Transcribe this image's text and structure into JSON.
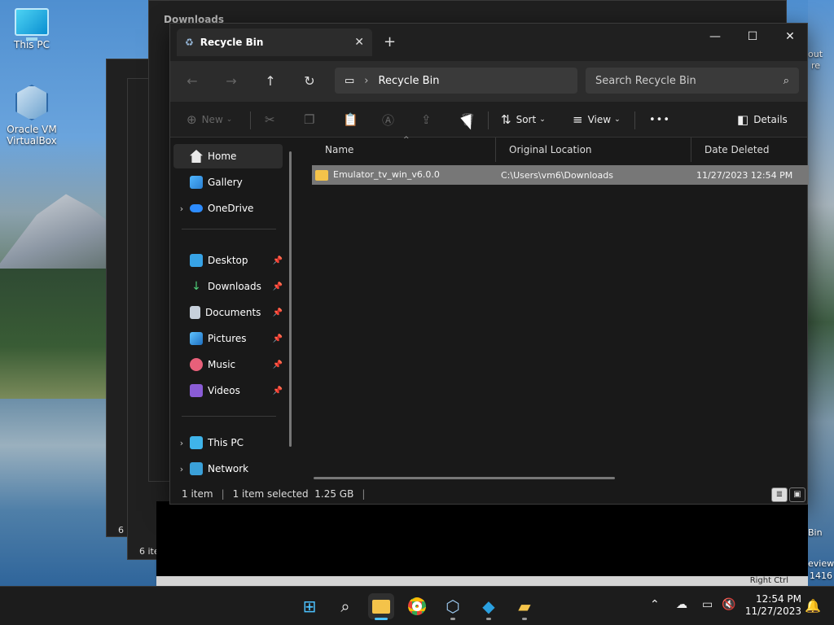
{
  "desktop": {
    "icons": [
      {
        "label": "This PC"
      },
      {
        "label": "Oracle VM VirtualBox"
      }
    ],
    "edge_texts": [
      "out",
      "re",
      "Bin",
      "eview",
      "1416"
    ]
  },
  "background_windows": {
    "downloads_tab": "Downloads",
    "items_count": "6 i",
    "items_count2": "6 ite",
    "vm_status": "Right Ctrl"
  },
  "window": {
    "tab_title": "Recycle Bin",
    "address": {
      "location": "Recycle Bin"
    },
    "search": {
      "placeholder": "Search Recycle Bin"
    },
    "toolbar": {
      "new_label": "New",
      "sort_label": "Sort",
      "view_label": "View",
      "more_label": "•••",
      "details_label": "Details"
    },
    "sidebar": {
      "home": "Home",
      "gallery": "Gallery",
      "onedrive": "OneDrive",
      "desktop": "Desktop",
      "downloads": "Downloads",
      "documents": "Documents",
      "pictures": "Pictures",
      "music": "Music",
      "videos": "Videos",
      "this_pc": "This PC",
      "network": "Network"
    },
    "columns": {
      "name": "Name",
      "original_location": "Original Location",
      "date_deleted": "Date Deleted"
    },
    "rows": [
      {
        "name": "Emulator_tv_win_v6.0.0",
        "location": "C:\\Users\\vm6\\Downloads",
        "date": "11/27/2023 12:54 PM"
      }
    ],
    "status": {
      "count": "1 item",
      "selection": "1 item selected  1.25 GB"
    }
  },
  "taskbar": {
    "time": "12:54 PM",
    "date": "11/27/2023"
  },
  "colors": {
    "accent": "#4cc2ff",
    "selected_row": "#777777",
    "folder": "#f4c34a"
  }
}
